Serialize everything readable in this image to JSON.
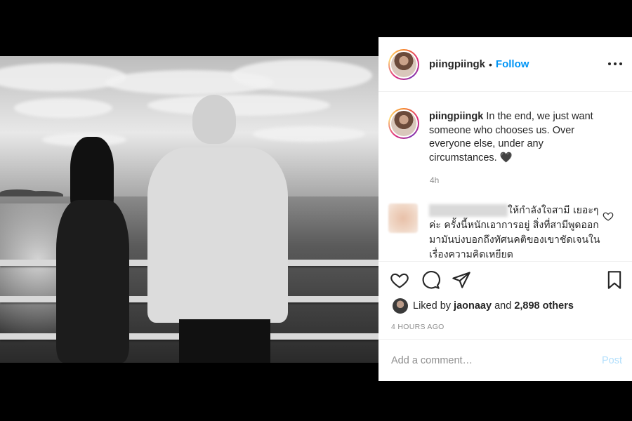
{
  "post": {
    "username": "piingpiingk",
    "separator": "•",
    "follow_label": "Follow",
    "more_icon": "more-options-icon"
  },
  "caption": {
    "username": "piingpiingk",
    "text": "In the end, we just want someone who chooses us. Over everyone else, under any circumstances. 🖤",
    "time": "4h"
  },
  "comments": [
    {
      "username_blurred": true,
      "text": "ให้กำลังใจสามี เยอะๆ ค่ะ ครั้งนี้หนักเอาการอยู่ สิ่งที่สามีพูดออกมามันบ่งบอกถึงทัศนคติของเขาชัดเจนในเรื่องความคิดเหยียด"
    }
  ],
  "likes": {
    "prefix": "Liked by",
    "liker": "jaonaay",
    "and": "and",
    "count": "2,898 others"
  },
  "timestamp": "4 HOURS AGO",
  "add_comment": {
    "placeholder": "Add a comment…",
    "post_label": "Post"
  },
  "colors": {
    "accent": "#0095f6",
    "post_disabled": "#b2dffc",
    "muted": "#8e8e8e",
    "text": "#262626"
  }
}
